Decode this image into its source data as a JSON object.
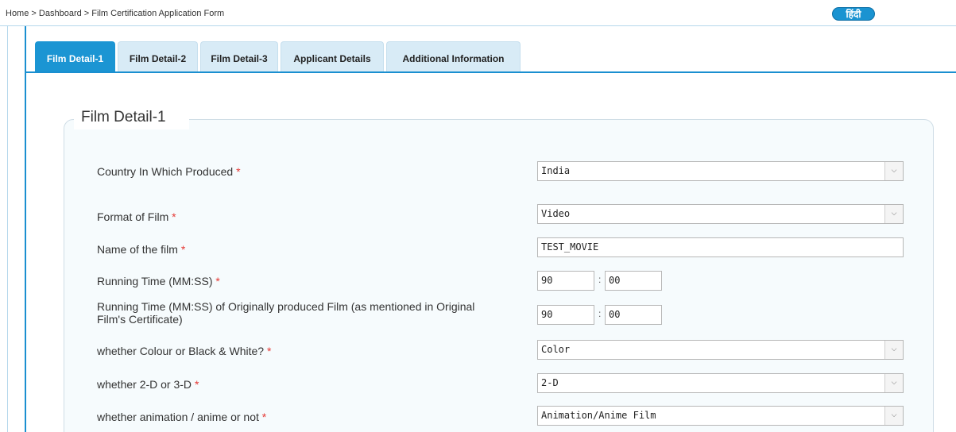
{
  "breadcrumb": {
    "home": "Home",
    "sep1": ">",
    "dashboard": "Dashboard",
    "sep2": ">",
    "current": "Film Certification Application Form"
  },
  "language_button": "हिंदी",
  "tabs": [
    {
      "label": "Film Detail-1",
      "active": true
    },
    {
      "label": "Film Detail-2",
      "active": false
    },
    {
      "label": "Film Detail-3",
      "active": false
    },
    {
      "label": "Applicant Details",
      "active": false
    },
    {
      "label": "Additional Information",
      "active": false
    }
  ],
  "section_title": "Film Detail-1",
  "required_mark": "*",
  "fields": {
    "country": {
      "label": "Country In Which Produced",
      "value": "India"
    },
    "format": {
      "label": "Format of Film",
      "value": "Video"
    },
    "name": {
      "label": "Name of the film",
      "value": "TEST_MOVIE"
    },
    "running_time": {
      "label": "Running Time (MM:SS)",
      "minutes": "90",
      "seconds": "00"
    },
    "original_running_time": {
      "label_line1": "Running Time (MM:SS) of Originally produced Film (as mentioned in Original",
      "label_line2": "Film's Certificate)",
      "minutes": "90",
      "seconds": "00"
    },
    "colour": {
      "label": "whether Colour or Black & White?",
      "value": "Color"
    },
    "dimension": {
      "label": "whether 2-D or 3-D",
      "value": "2-D"
    },
    "animation": {
      "label": "whether animation / anime or not",
      "value": "Animation/Anime Film"
    }
  },
  "colon": ":",
  "caret_icon": "chevron-down-icon",
  "colors": {
    "accent": "#1b95d3",
    "tab_inactive": "#d8ebf6",
    "required": "#e53935"
  }
}
